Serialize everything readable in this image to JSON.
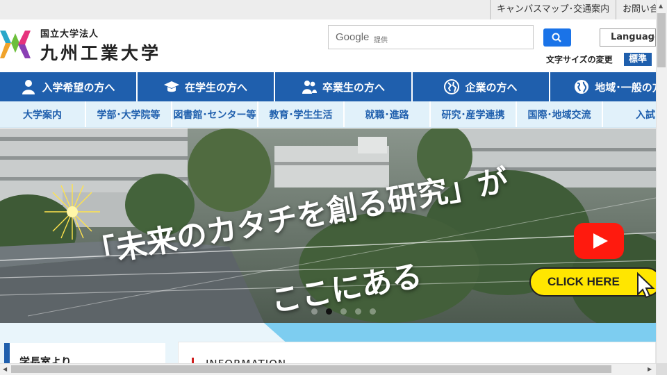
{
  "util_links": [
    "キャンパスマップ･交通案内",
    "お問い合"
  ],
  "org": {
    "subtitle": "国立大学法人",
    "name": "九州工業大学"
  },
  "search": {
    "brand": "Google",
    "provider": "提供"
  },
  "language_button": "Language",
  "font_size": {
    "label": "文字サイズの変更",
    "standard": "標準"
  },
  "primary_nav": [
    {
      "label": "入学希望の方へ",
      "icon": "person-icon"
    },
    {
      "label": "在学生の方へ",
      "icon": "graduation-cap-icon"
    },
    {
      "label": "卒業生の方へ",
      "icon": "people-icon"
    },
    {
      "label": "企業の方へ",
      "icon": "globe-icon"
    },
    {
      "label": "地域･一般の方",
      "icon": "earth-icon"
    }
  ],
  "secondary_nav": [
    "大学案内",
    "学部･大学院等",
    "図書館･センター等",
    "教育･学生生活",
    "就職･進路",
    "研究･産学連携",
    "国際･地域交流",
    "入試"
  ],
  "hero": {
    "headline": "「未来のカタチを創る研究」が",
    "subline": "ここにある",
    "cta": "CLICK HERE",
    "slide_count": 5,
    "active_slide": 2
  },
  "sidebar": {
    "title": "学長室より"
  },
  "info": {
    "title": "INFORMATION"
  },
  "colors": {
    "brand_blue": "#1f5fad",
    "light_blue": "#e1f1fa",
    "accent_red": "#d01f1f",
    "cta_yellow": "#ffe600"
  }
}
